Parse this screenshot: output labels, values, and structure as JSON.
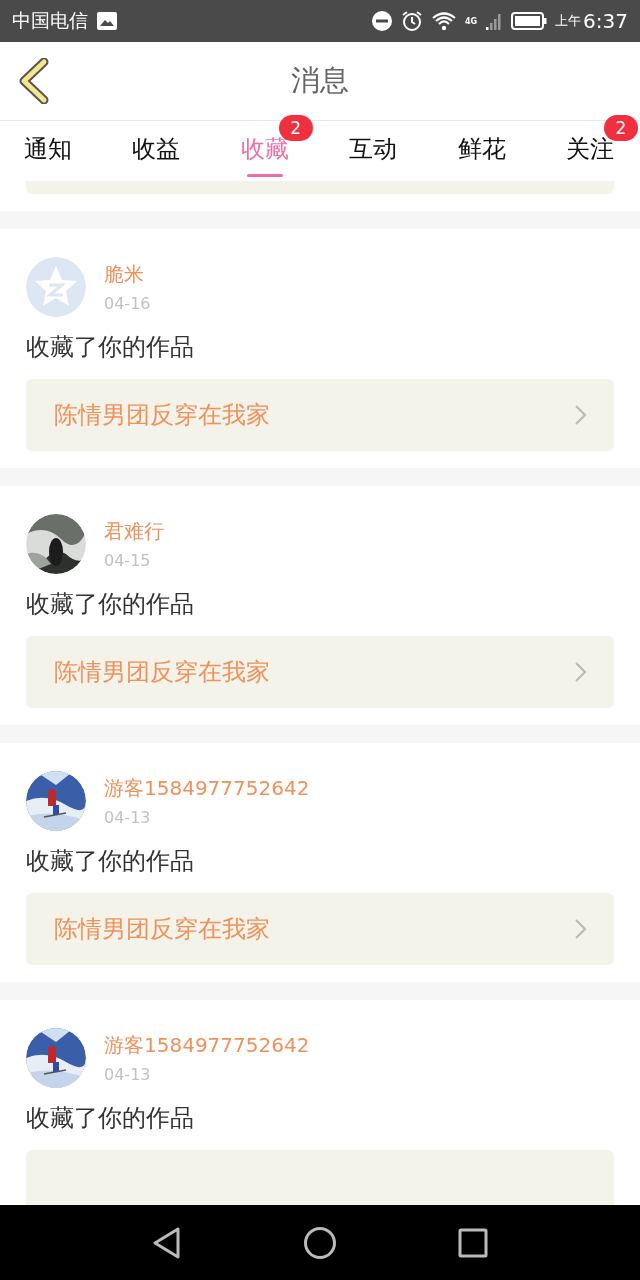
{
  "status_bar": {
    "carrier": "中国电信",
    "network": "4G",
    "time_prefix": "上午",
    "time": "6:37"
  },
  "header": {
    "title": "消息"
  },
  "tabs": [
    {
      "label": "通知",
      "selected": false
    },
    {
      "label": "收益",
      "selected": false
    },
    {
      "label": "收藏",
      "selected": true,
      "badge": "2"
    },
    {
      "label": "互动",
      "selected": false
    },
    {
      "label": "鲜花",
      "selected": false
    },
    {
      "label": "关注",
      "selected": false,
      "badge": "2"
    }
  ],
  "messages": [
    {
      "avatar": {
        "kind": "default"
      },
      "name": "脆米",
      "date": "04-16",
      "action": "收藏了你的作品",
      "work_title": "陈情男团反穿在我家"
    },
    {
      "name": "君难行",
      "date": "04-15",
      "action": "收藏了你的作品",
      "work_title": "陈情男团反穿在我家"
    },
    {
      "name": "游客1584977752642",
      "date": "04-13",
      "action": "收藏了你的作品",
      "work_title": "陈情男团反穿在我家"
    },
    {
      "name": "游客1584977752642",
      "date": "04-13",
      "action": "收藏了你的作品"
    }
  ]
}
